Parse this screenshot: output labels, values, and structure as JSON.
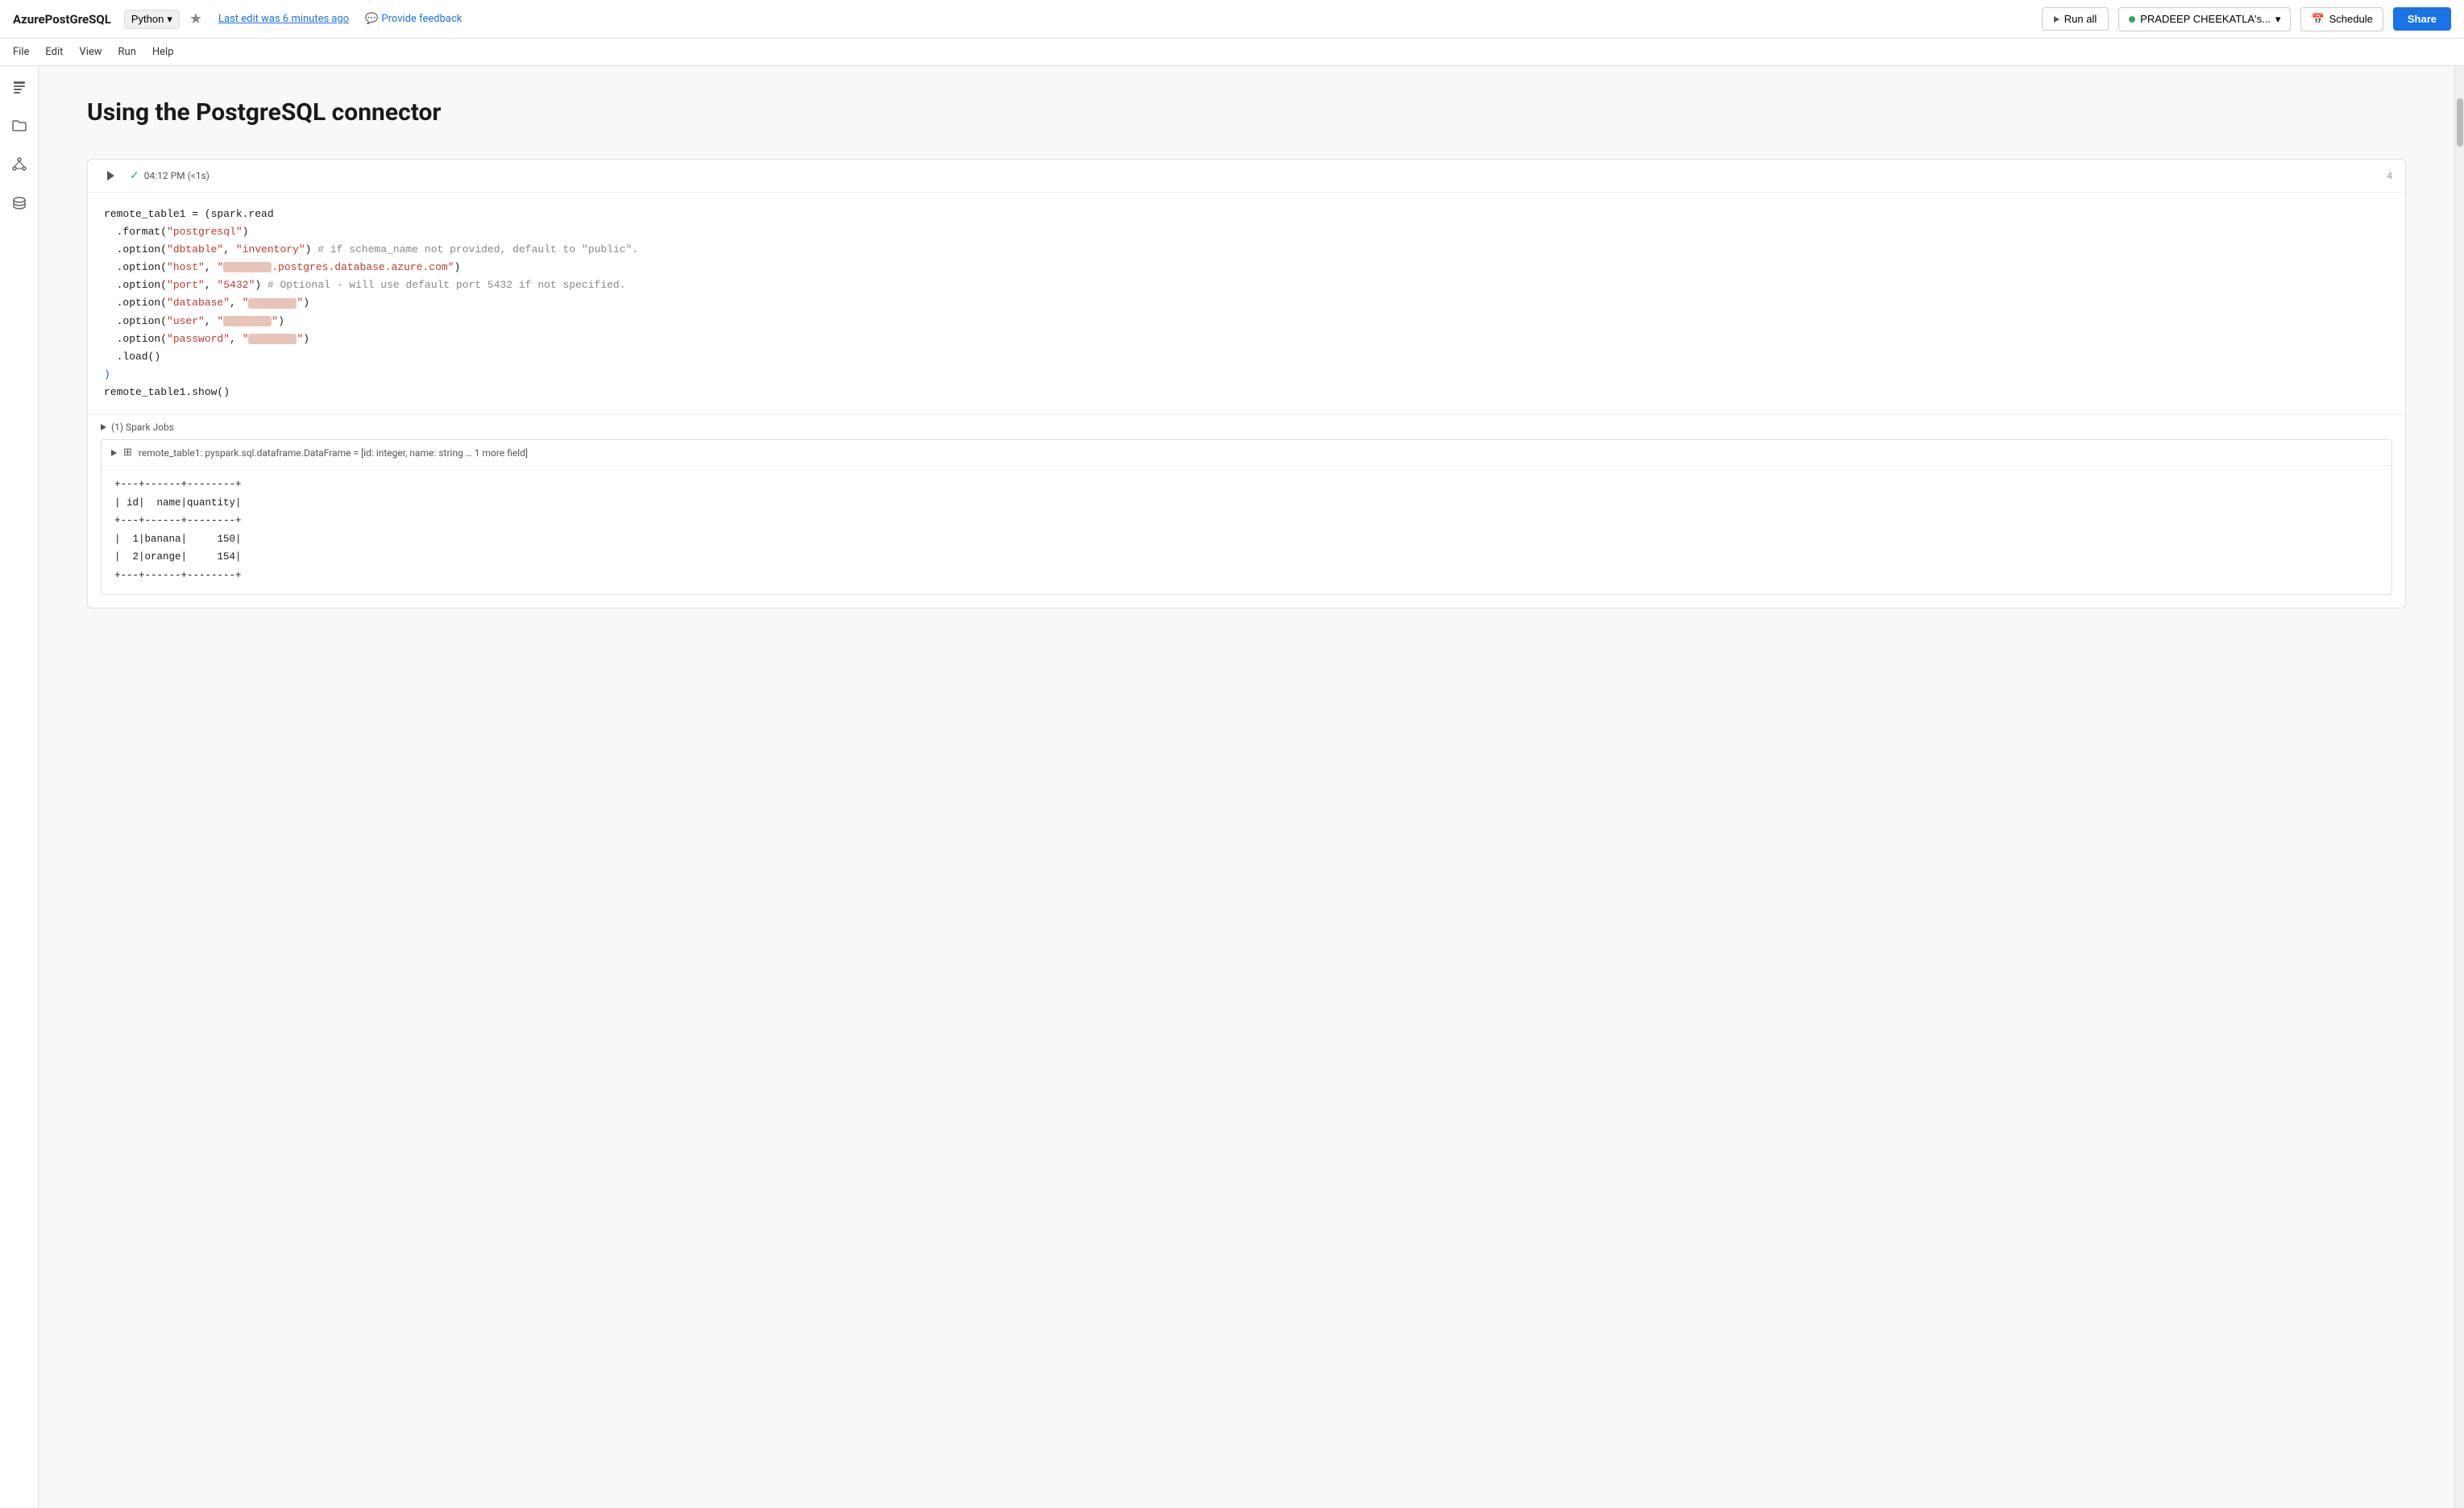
{
  "app": {
    "title": "AzurePostGreSQL",
    "lang": "Python",
    "star_icon": "★",
    "edit_info": "Last edit was 6 minutes ago",
    "feedback": "Provide feedback",
    "run_all_label": "Run all",
    "user_label": "PRADEEP CHEEKATLA's...",
    "schedule_label": "Schedule",
    "share_label": "Share"
  },
  "menu": {
    "items": [
      "File",
      "Edit",
      "View",
      "Run",
      "Help"
    ]
  },
  "sidebar": {
    "icons": [
      "≡",
      "📁",
      "△",
      "⟳"
    ]
  },
  "notebook": {
    "title": "Using the PostgreSQL connector"
  },
  "cell": {
    "run_btn": "▶",
    "status_check": "✓",
    "time": "04:12 PM (<1s)",
    "cell_number": "4",
    "code_lines": [
      "remote_table1 = (spark.read",
      "  .format(\"postgresql\")",
      "  .option(\"dbtable\", \"inventory\") # if schema_name not provided, default to \"public\".",
      "  .option(\"host\", \"[REDACTED].postgres.database.azure.com\")",
      "  .option(\"port\", \"5432\") # Optional - will use default port 5432 if not specified.",
      "  .option(\"database\", \"[REDACTED]\")",
      "  .option(\"user\", \"[REDACTED]\")",
      "  .option(\"password\", \"[REDACTED]\")",
      "  .load()",
      ")",
      "remote_table1.show()"
    ],
    "spark_jobs": "(1) Spark Jobs",
    "output_header": "remote_table1:  pyspark.sql.dataframe.DataFrame = [id: integer, name: string … 1 more field]",
    "output_table": "+---+------+--------+\n| id|  name|quantity|\n+---+------+--------+\n|  1|banana|     150|\n|  2|orange|     154|\n+---+------+--------+"
  }
}
